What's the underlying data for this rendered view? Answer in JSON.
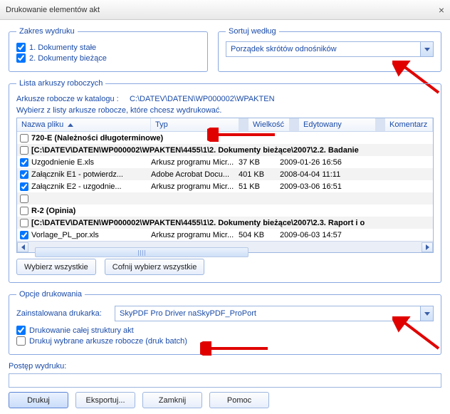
{
  "title": "Drukowanie elementów akt",
  "groups": {
    "zakres": "Zakres wydruku",
    "sort": "Sortuj według",
    "lista": "Lista arkuszy roboczych",
    "opcje": "Opcje drukowania"
  },
  "zakres": {
    "opt1": "1. Dokumenty stałe",
    "opt2": "2. Dokumenty bieżące"
  },
  "sort": {
    "value": "Porządek skrótów odnośników"
  },
  "lista": {
    "pathLabel": "Arkusze robocze w katalogu :",
    "path": "C:\\DATEV\\DATEN\\WP000002\\WPAKTEN",
    "instr": "Wybierz z listy arkusze robocze, które chcesz wydrukować.",
    "cols": {
      "name": "Nazwa pliku",
      "typ": "Typ",
      "size": "Wielkość",
      "edit": "Edytowany",
      "kom": "Komentarz"
    },
    "rows": [
      {
        "chk": false,
        "bold": true,
        "name": "720-E (Należności długoterminowe)"
      },
      {
        "chk": false,
        "bold": true,
        "name": "[C:\\DATEV\\DATEN\\WP000002\\WPAKTEN\\4455\\1\\2. Dokumenty bieżące\\2007\\2.2. Badanie"
      },
      {
        "chk": true,
        "name": "Uzgodnienie E.xls",
        "typ": "Arkusz programu Micr...",
        "size": "37 KB",
        "edit": "2009-01-26 16:56"
      },
      {
        "chk": true,
        "name": "Załącznik E1 - potwierdz...",
        "typ": "Adobe Acrobat Docu...",
        "size": "401 KB",
        "edit": "2008-04-04 11:11"
      },
      {
        "chk": true,
        "name": "Załącznik E2 - uzgodnie...",
        "typ": "Arkusz programu Micr...",
        "size": "51 KB",
        "edit": "2009-03-06 16:51"
      },
      {
        "chk": false,
        "name": ""
      },
      {
        "chk": false,
        "bold": true,
        "name": "R-2 (Opinia)"
      },
      {
        "chk": false,
        "bold": true,
        "name": "[C:\\DATEV\\DATEN\\WP000002\\WPAKTEN\\4455\\1\\2. Dokumenty bieżące\\2007\\2.3. Raport i o"
      },
      {
        "chk": true,
        "name": "Vorlage_PL_por.xls",
        "typ": "Arkusz programu Micr...",
        "size": "504 KB",
        "edit": "2009-06-03 14:57"
      }
    ],
    "selectAll": "Wybierz wszystkie",
    "deselectAll": "Cofnij wybierz wszystkie"
  },
  "opcje": {
    "printerLabel": "Zainstalowana drukarka:",
    "printer": "SkyPDF Pro Driver naSkyPDF_ProPort",
    "chk1": "Drukowanie całej struktury akt",
    "chk2": "Drukuj wybrane arkusze robocze (druk batch)"
  },
  "progressLabel": "Postęp wydruku:",
  "buttons": {
    "print": "Drukuj",
    "export": "Eksportuj...",
    "close": "Zamknij",
    "help": "Pomoc"
  }
}
